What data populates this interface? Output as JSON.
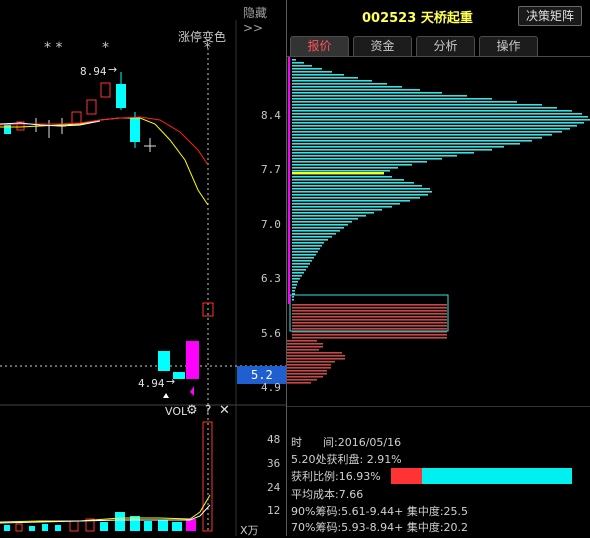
{
  "left_panel": {
    "hide_button": "隐藏>>",
    "limit_change_label": "涨停变色",
    "stars": [
      "* *",
      "*",
      "*"
    ],
    "high_annot": "8.94",
    "low_annot": "4.94",
    "vol_label": "VOL",
    "gear_icon": "gear-icon",
    "help_icon": "question-icon",
    "close_icon": "close-icon",
    "vol_ticks": [
      "48",
      "36",
      "24",
      "12"
    ],
    "vol_unit": "X万",
    "current_price": "5.2"
  },
  "right_panel": {
    "stock_code": "002523",
    "stock_name": "天桥起重",
    "decision_button": "决策矩阵",
    "tabs": [
      "报价",
      "资金",
      "分析",
      "操作"
    ],
    "active_tab": 0,
    "price_ticks": [
      "8.4",
      "7.7",
      "7.0",
      "6.3",
      "5.6",
      "4.9"
    ],
    "info": {
      "time_label": "时",
      "time_mid": "间:",
      "time_value": "2016/05/16",
      "profit_at": "5.20处获利盘: 2.91%",
      "profit_ratio_label": "获利比例:16.93%",
      "avg_cost": "平均成本:7.66",
      "chip90": "90%筹码:5.61-9.44+ 集中度:25.5",
      "chip70": "70%筹码:5.93-8.94+ 集中度:20.2"
    },
    "profit_ratio": 0.1693
  },
  "colors": {
    "up": "#ff3333",
    "down": "#00ffff",
    "ma_yellow": "#ffff00",
    "ma_red": "#ff2020",
    "chip_cyan": "#3ce0e0",
    "chip_red": "#c84848",
    "magenta": "#ff00ff",
    "price_box": "#1f5fd0"
  }
}
